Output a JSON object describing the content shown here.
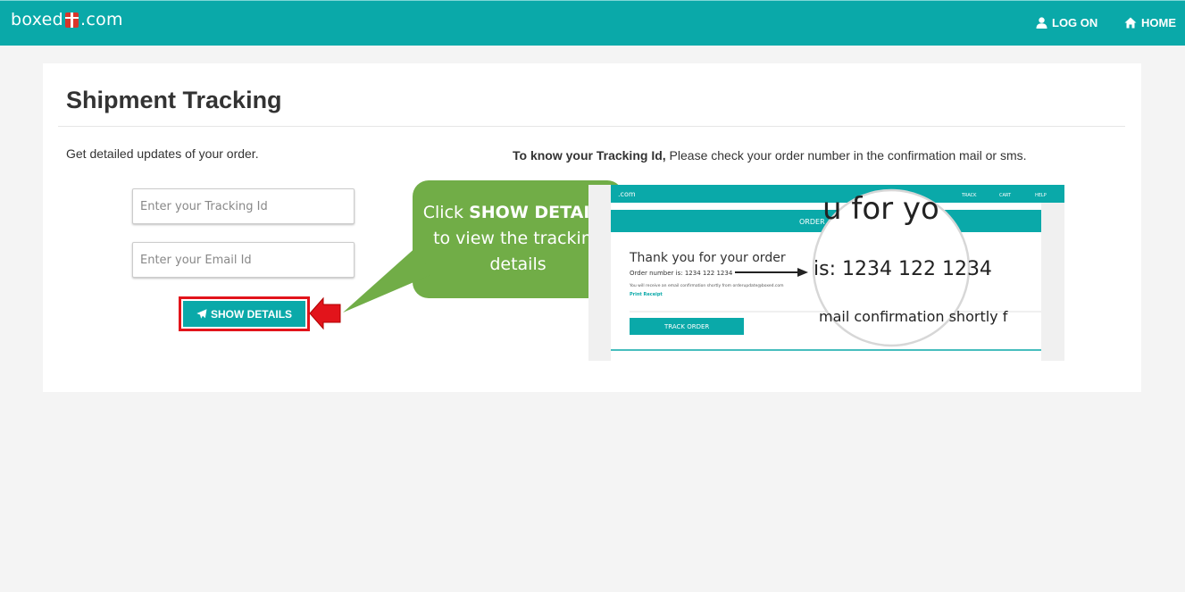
{
  "header": {
    "brand_left": "boxed",
    "brand_right": ".com",
    "logon_label": "LOG ON",
    "home_label": "HOME"
  },
  "main": {
    "title": "Shipment Tracking",
    "intro": "Get detailed updates of your order.",
    "hint_bold": "To know your Tracking Id,",
    "hint_rest": " Please check your order number in the confirmation mail or sms.",
    "tracking_placeholder": "Enter your Tracking Id",
    "email_placeholder": "Enter your Email Id",
    "show_details_label": "SHOW DETAILS"
  },
  "callout": {
    "prefix": "Click ",
    "bold": "SHOW DETAILS",
    "line2": "to view the tracking",
    "line3": "details"
  },
  "example": {
    "brand": ".com",
    "nav_track": "TRACK",
    "nav_cart": "CART",
    "nav_help": "HELP",
    "banner": "ORDER",
    "thanks": "Thank you for your order",
    "order_number": "Order number is: 1234 122 1234",
    "confirm_note": "You will receive an email confirmation shortly from orderupdate@boxed.com",
    "print_receipt": "Print Receipt",
    "track_order": "TRACK ORDER",
    "zoom_top": "u for yo",
    "zoom_mid": "is: 1234 122 1234",
    "zoom_bottom": "mail confirmation shortly f"
  },
  "colors": {
    "brand": "#0aa9a9",
    "accent_red": "#e2141b",
    "callout_green": "#71ad47"
  },
  "icons": [
    "user-icon",
    "home-icon",
    "send-icon",
    "gift-icon"
  ]
}
